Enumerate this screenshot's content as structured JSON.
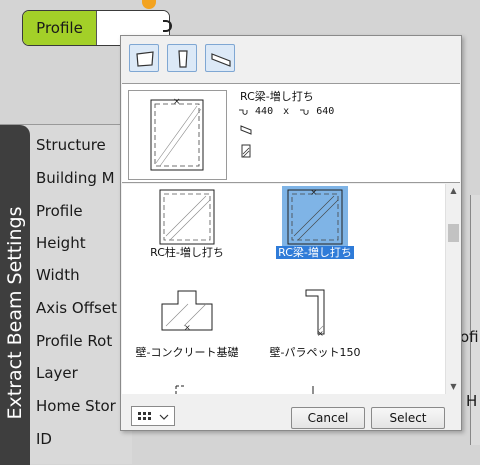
{
  "canvas": {
    "profile_node_label": "Profile",
    "settings_title": "Extract Beam Settings",
    "properties": [
      "Structure",
      "Building M",
      "Profile",
      "Height",
      "Width",
      "Axis Offset",
      "Profile Rot",
      "Layer",
      "Home Stor",
      "ID"
    ],
    "right_fragments": [
      "ofil",
      "H"
    ]
  },
  "popup": {
    "toolbar_tools": [
      "beam-profile-icon",
      "column-profile-icon",
      "wall-profile-icon"
    ],
    "detail": {
      "name": "RC梁-増し打ち",
      "width": "440",
      "separator": "x",
      "height": "640"
    },
    "items": [
      {
        "label": "RC柱-増し打ち",
        "selected": false
      },
      {
        "label": "RC梁-増し打ち",
        "selected": true
      },
      {
        "label": "壁-コンクリート基礎",
        "selected": false
      },
      {
        "label": "壁-パラペット150",
        "selected": false
      }
    ],
    "buttons": {
      "cancel": "Cancel",
      "select": "Select"
    },
    "colors": {
      "selection": "#2f7bd8",
      "selection_thumb": "#7fb4e6",
      "node_green": "#a3d028"
    }
  }
}
